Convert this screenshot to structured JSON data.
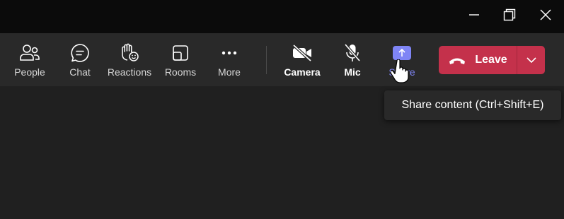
{
  "window_controls": {
    "minimize_icon": "minimize-icon",
    "restore_icon": "restore-icon",
    "close_icon": "close-icon"
  },
  "toolbar": {
    "items": [
      {
        "label": "People",
        "icon": "people-icon"
      },
      {
        "label": "Chat",
        "icon": "chat-icon"
      },
      {
        "label": "Reactions",
        "icon": "reactions-icon"
      },
      {
        "label": "Rooms",
        "icon": "rooms-icon"
      },
      {
        "label": "More",
        "icon": "more-icon"
      },
      {
        "label": "Camera",
        "icon": "camera-off-icon"
      },
      {
        "label": "Mic",
        "icon": "mic-off-icon"
      },
      {
        "label": "Share",
        "icon": "share-icon"
      }
    ],
    "leave": {
      "label": "Leave",
      "icon": "phone-hangup-icon",
      "caret_icon": "chevron-down-icon"
    }
  },
  "tooltip": {
    "text": "Share content (Ctrl+Shift+E)"
  },
  "colors": {
    "accent": "#7f85f5",
    "leave": "#c4314b",
    "titlebar": "#0b0b0b",
    "toolbar": "#292929",
    "stage": "#202020"
  }
}
